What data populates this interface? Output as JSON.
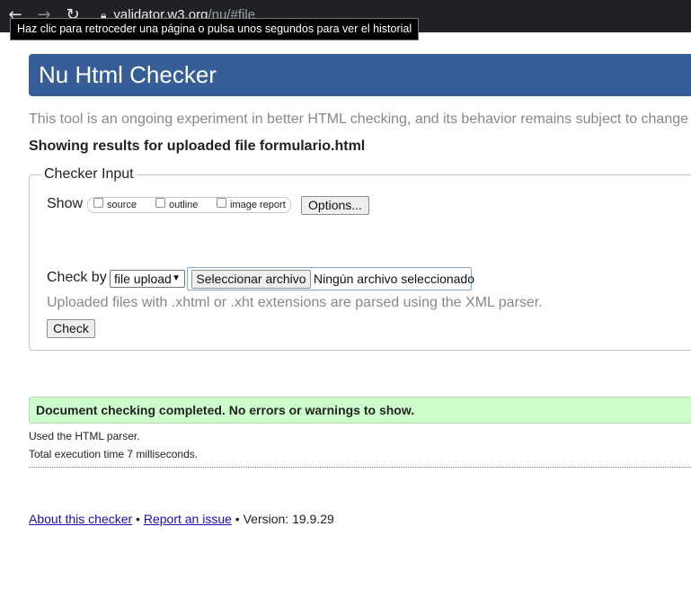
{
  "browser": {
    "url_host": "validator.w3.org",
    "url_path": "/nu/#file",
    "tooltip": "Haz clic para retroceder una página o pulsa unos segundos para ver el historial",
    "icons": [
      "back-arrow-icon",
      "forward-arrow-icon",
      "reload-icon",
      "lock-icon"
    ]
  },
  "header": {
    "title": "Nu Html Checker"
  },
  "intro": "This tool is an ongoing experiment in better HTML checking, and its behavior remains subject to change",
  "showing": "Showing results for uploaded file formulario.html",
  "checker_input": {
    "legend": "Checker Input",
    "show_label": "Show",
    "options": [
      {
        "label": "source",
        "checked": false
      },
      {
        "label": "outline",
        "checked": false
      },
      {
        "label": "image report",
        "checked": false
      }
    ],
    "options_button": "Options...",
    "check_by_label": "Check by",
    "check_by_value": "file upload",
    "file_button": "Seleccionar archivo",
    "file_status": "Ningún archivo seleccionado",
    "note": "Uploaded files with .xhtml or .xht extensions are parsed using the XML parser.",
    "check_button": "Check"
  },
  "result": {
    "message": "Document checking completed. No errors or warnings to show.",
    "parser": "Used the HTML parser.",
    "time": "Total execution time 7 milliseconds."
  },
  "footer": {
    "about": "About this checker",
    "sep1": " • ",
    "report": "Report an issue",
    "version": " • Version: 19.9.29"
  },
  "colors": {
    "banner": "#365d95",
    "success_bg": "#ccffcc",
    "link": "#1a0dab"
  }
}
